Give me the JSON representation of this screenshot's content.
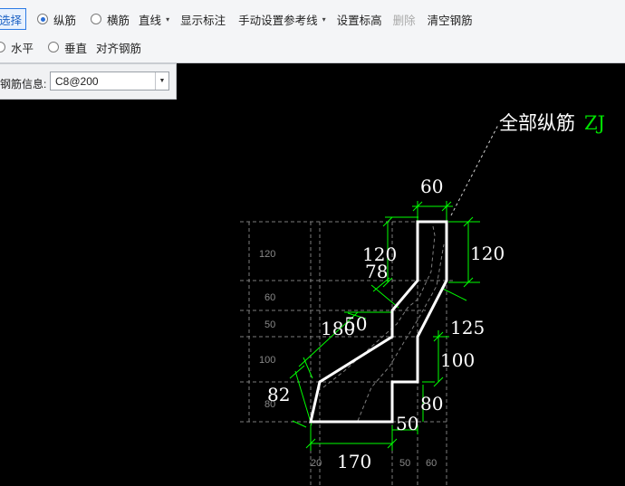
{
  "toolbar": {
    "select_label": "选择",
    "radio_longitudinal": "纵筋",
    "radio_transverse": "横筋",
    "line_label": "直线",
    "show_annotation": "显示标注",
    "manual_reference": "手动设置参考线",
    "set_elevation": "设置标高",
    "delete_label": "删除",
    "clear_rebar": "清空钢筋",
    "radio_horizontal": "水平",
    "radio_vertical": "垂直",
    "align_rebar": "对齐钢筋"
  },
  "rebar_panel": {
    "label": "钢筋信息:",
    "value": "C8@200"
  },
  "drawing": {
    "leader_label": "全部纵筋",
    "leader_code": "ZJ",
    "dims": {
      "top_width": "60",
      "right_upper": "120",
      "inner_upper": "120",
      "inner_78": "78",
      "slope_180": "180",
      "slope_50": "50",
      "right_125": "125",
      "right_100": "100",
      "left_82": "82",
      "right_80": "80",
      "bottom_50": "50",
      "bottom_170": "170"
    },
    "grid_left": [
      "120",
      "60",
      "50",
      "100",
      "80"
    ],
    "grid_bottom": [
      "20",
      "50",
      "60"
    ],
    "colors": {
      "outline": "#ffffff",
      "dimension": "#00ff00",
      "grid": "#888888",
      "leader_code": "#00e000"
    }
  }
}
